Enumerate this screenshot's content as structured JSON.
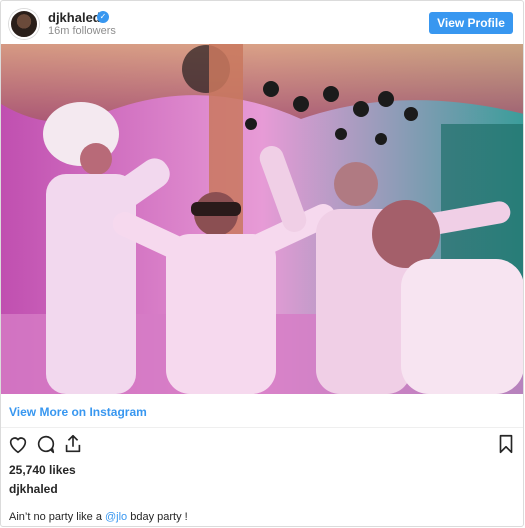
{
  "header": {
    "username": "djkhaled",
    "followers": "16m followers",
    "view_profile_label": "View Profile",
    "verified_glyph": "✓"
  },
  "media": {
    "description_icon": "party-photo"
  },
  "view_more_label": "View More on Instagram",
  "actions": {
    "icons": [
      "heart-icon",
      "comment-icon",
      "share-icon",
      "bookmark-icon"
    ]
  },
  "likes": "25,740 likes",
  "owner": "djkhaled",
  "caption": {
    "prefix": "Ain’t no party like a ",
    "mention": "@jlo",
    "suffix": " bday party !"
  },
  "colors": {
    "accent": "#3897f0",
    "text": "#262626",
    "muted": "#8e8e8e"
  }
}
